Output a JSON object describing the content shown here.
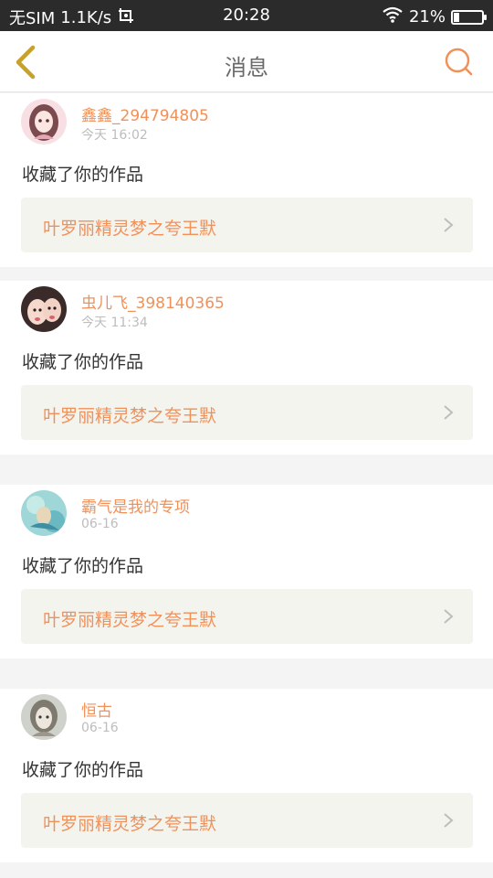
{
  "status_bar": {
    "carrier": "无SIM",
    "speed": "1.1K/s",
    "time": "20:28",
    "battery_text": "21%",
    "battery_level": 0.21,
    "icons": [
      "screenshot-icon",
      "wifi-icon",
      "battery-icon"
    ]
  },
  "header": {
    "title": "消息",
    "back_icon": "chevron-left-icon",
    "search_icon": "search-icon"
  },
  "colors": {
    "accent": "#f0915a",
    "back_arrow": "#c8a12a",
    "status_bar_bg": "#2b2b2b"
  },
  "messages": [
    {
      "username": "鑫鑫_294794805",
      "time": "今天 16:02",
      "action": "收藏了你的作品",
      "work_title": "叶罗丽精灵梦之夸王默"
    },
    {
      "username": "虫儿飞_398140365",
      "time": "今天 11:34",
      "action": "收藏了你的作品",
      "work_title": "叶罗丽精灵梦之夸王默"
    },
    {
      "username": "霸气是我的专项",
      "time": "06-16",
      "action": "收藏了你的作品",
      "work_title": "叶罗丽精灵梦之夸王默"
    },
    {
      "username": "恒古",
      "time": "06-16",
      "action": "收藏了你的作品",
      "work_title": "叶罗丽精灵梦之夸王默"
    }
  ]
}
